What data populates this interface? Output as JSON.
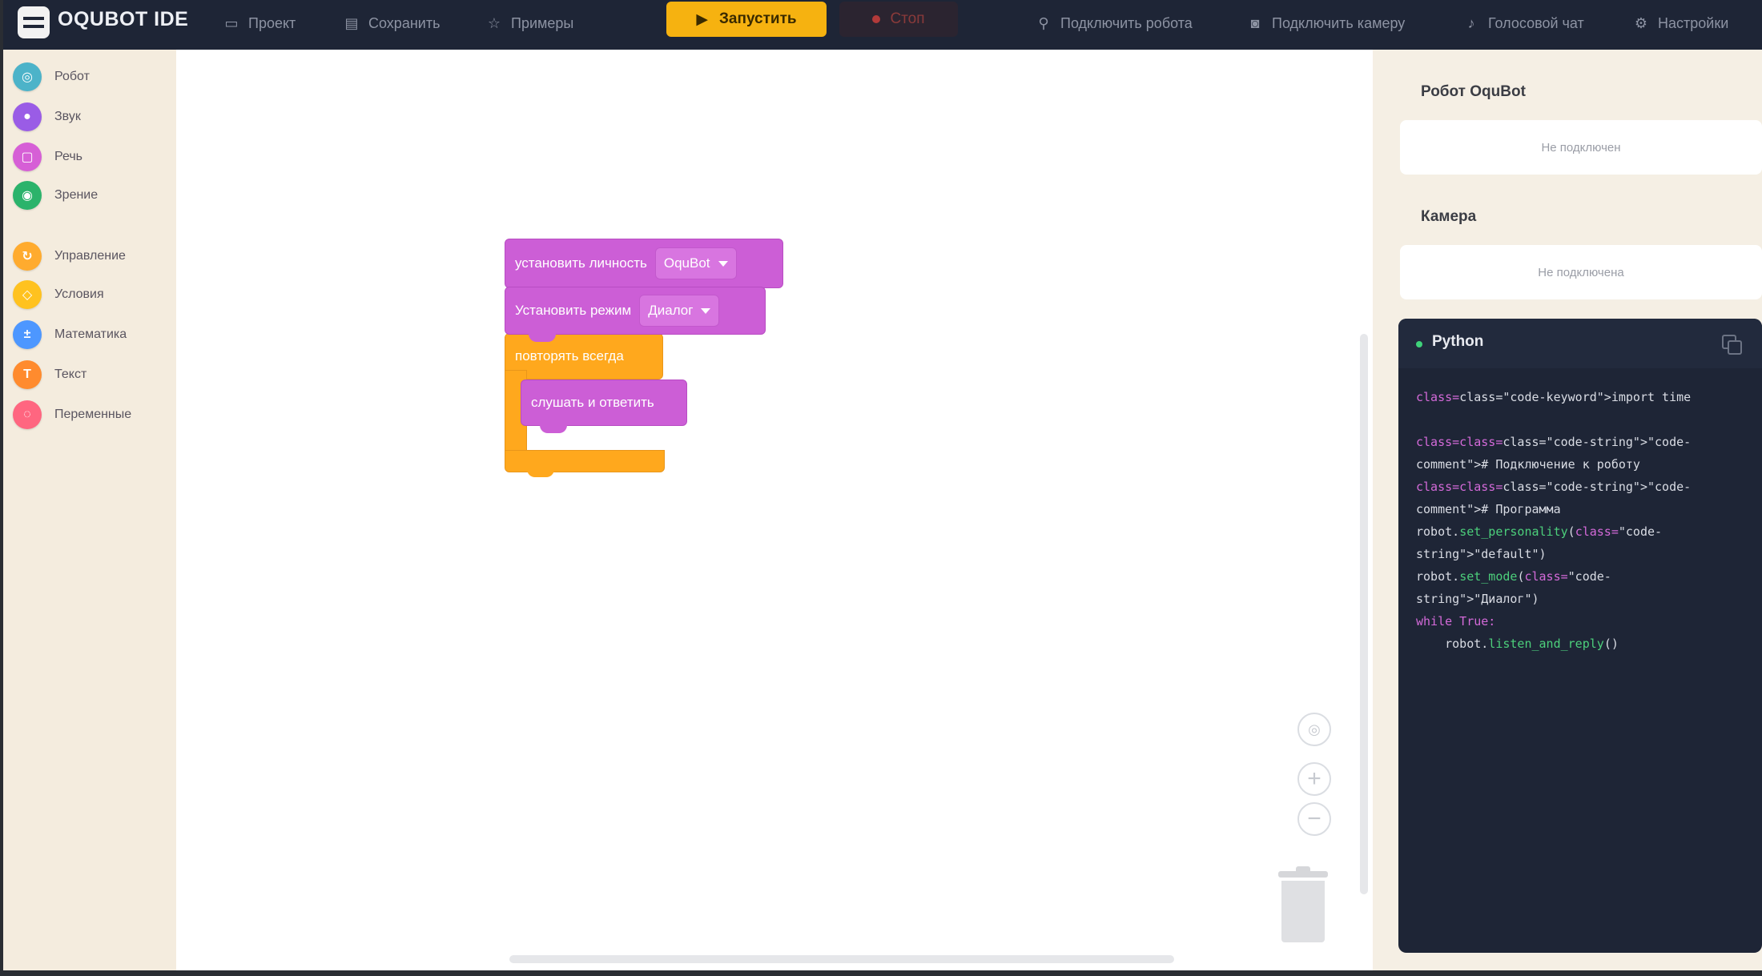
{
  "app": {
    "title": "OQUBOT IDE",
    "accent_color": "#f6b210",
    "topbar_color": "#1e2536"
  },
  "toolbar": {
    "project_label": "Проект",
    "save_label": "Сохранить",
    "examples_label": "Примеры",
    "run_label": "Запустить",
    "stop_label": "Стоп",
    "connect_robot_label": "Подключить робота",
    "connect_camera_label": "Подключить камеру",
    "voice_chat_label": "Голосовой чат",
    "settings_label": "Настройки"
  },
  "sidebar": {
    "categories": [
      {
        "label": "Робот",
        "color": "#4cb3c9",
        "icon": "robot-icon"
      },
      {
        "label": "Звук",
        "color": "#9a5ce6",
        "icon": "sound-icon"
      },
      {
        "label": "Речь",
        "color": "#d65fd6",
        "icon": "speech-icon"
      },
      {
        "label": "Зрение",
        "color": "#2bb36b",
        "icon": "eye-icon"
      },
      {
        "label": "Управление",
        "color": "#ffab2e",
        "icon": "control-icon"
      },
      {
        "label": "Условия",
        "color": "#ffc21f",
        "icon": "conditions-icon"
      },
      {
        "label": "Математика",
        "color": "#4d97ff",
        "icon": "math-icon"
      },
      {
        "label": "Текст",
        "color": "#ff8b2e",
        "icon": "text-icon"
      },
      {
        "label": "Переменные",
        "color": "#ff6680",
        "icon": "variables-icon"
      }
    ]
  },
  "workspace": {
    "blocks": {
      "set_personality": {
        "label": "установить личность",
        "value": "OquBot"
      },
      "set_mode": {
        "label": "Установить режим",
        "value": "Диалог"
      },
      "repeat_forever": {
        "label": "повторять всегда"
      },
      "listen_reply": {
        "label": "слушать и ответить"
      }
    }
  },
  "right_panel": {
    "robot_title": "Робот OquBot",
    "robot_status": "Не подключен",
    "camera_title": "Камера",
    "camera_status": "Не подключена",
    "code_title": "Python",
    "code_lines": [
      [
        {
          "t": "class=\"code-keyword\">import time",
          "c": "c-pl",
          "k": "class="
        }
      ],
      [
        {
          "t": "",
          "c": "c-pl"
        }
      ],
      [
        {
          "t": "class=\"code-string\">\"code-",
          "c": "c-pl",
          "k": "class=class="
        }
      ],
      [
        {
          "t": "comment\"># Подключение к роботу",
          "c": "c-pl"
        }
      ],
      [
        {
          "t": "class=\"code-string\">\"code-",
          "c": "c-pl",
          "k": "class=class="
        }
      ],
      [
        {
          "t": "comment\"># Программа",
          "c": "c-pl"
        }
      ],
      [
        {
          "t": "robot.",
          "c": "c-pl"
        },
        {
          "t": "set_personality",
          "c": "c-fn"
        },
        {
          "t": "(",
          "c": "c-pl"
        },
        {
          "t": "class=",
          "c": "c-kw"
        },
        {
          "t": "\"code-",
          "c": "c-pl"
        }
      ],
      [
        {
          "t": "string\">\"default\")",
          "c": "c-pl"
        }
      ],
      [
        {
          "t": "robot.",
          "c": "c-pl"
        },
        {
          "t": "set_mode",
          "c": "c-fn"
        },
        {
          "t": "(",
          "c": "c-pl"
        },
        {
          "t": "class=",
          "c": "c-kw"
        },
        {
          "t": "\"code-",
          "c": "c-pl"
        }
      ],
      [
        {
          "t": "string\">\"Диалог\")",
          "c": "c-pl"
        }
      ],
      [
        {
          "t": "while True:",
          "c": "c-kw"
        }
      ],
      [
        {
          "t": "    robot.",
          "c": "c-pl"
        },
        {
          "t": "listen_and_reply",
          "c": "c-fn"
        },
        {
          "t": "()",
          "c": "c-pl"
        }
      ]
    ]
  }
}
